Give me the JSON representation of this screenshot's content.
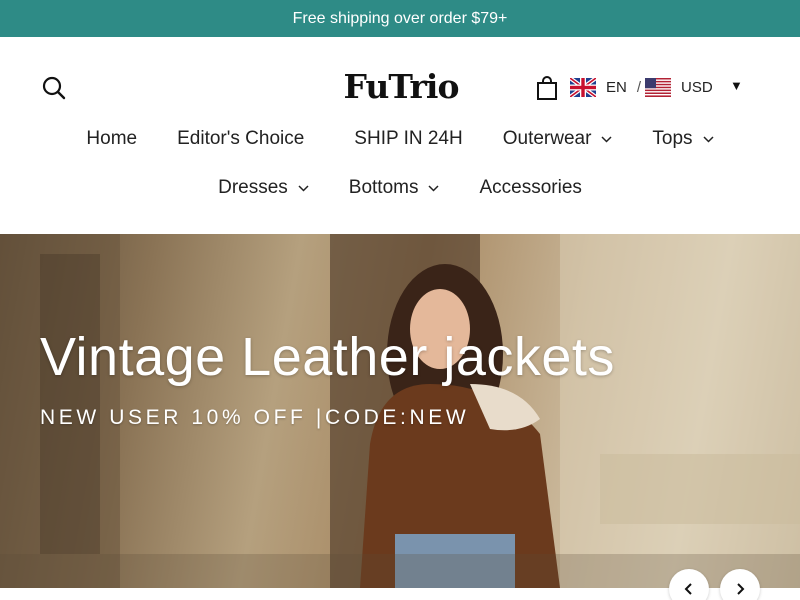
{
  "announcement": {
    "text": "Free shipping over order $79+"
  },
  "header": {
    "logo_text": "FuTrio",
    "search_icon": "search-icon",
    "cart_icon": "cart-icon",
    "locale": {
      "language": "EN",
      "separator": "/",
      "currency": "USD",
      "caret": "▼"
    }
  },
  "nav": {
    "row1": [
      {
        "label": "Home",
        "dropdown": false
      },
      {
        "label": "Editor's Choice",
        "dropdown": false
      },
      {
        "label": "SHIP IN 24H",
        "dropdown": false
      },
      {
        "label": "Outerwear",
        "dropdown": true
      },
      {
        "label": "Tops",
        "dropdown": true
      }
    ],
    "row2": [
      {
        "label": "Dresses",
        "dropdown": true
      },
      {
        "label": "Bottoms",
        "dropdown": true
      },
      {
        "label": "Accessories",
        "dropdown": false
      }
    ]
  },
  "hero": {
    "title": "Vintage Leather jackets",
    "subtitle": "NEW USER 10% OFF |CODE:NEW",
    "prev_icon": "chevron-left-icon",
    "next_icon": "chevron-right-icon"
  },
  "colors": {
    "announcement_bg": "#2e8b86",
    "text": "#222222"
  }
}
